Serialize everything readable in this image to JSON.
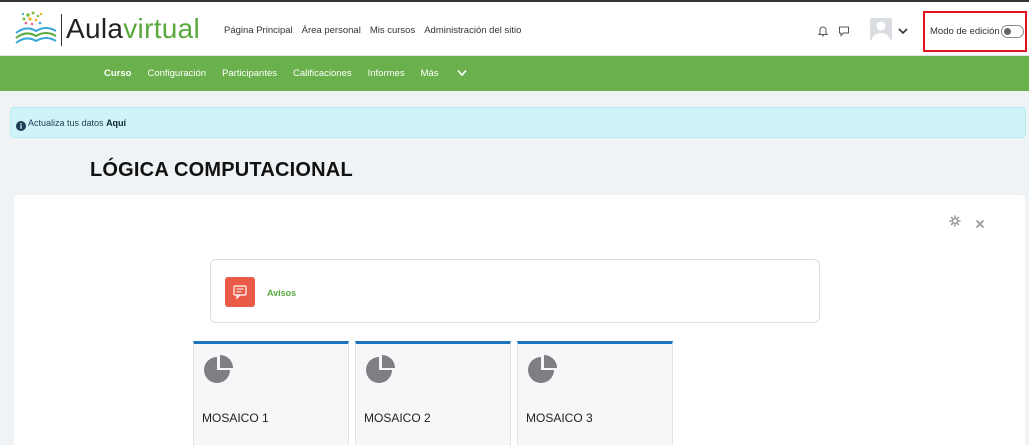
{
  "header": {
    "brand_prefix": "Aula",
    "brand_suffix": "virtual",
    "nav": [
      "Página Principal",
      "Área personal",
      "Mis cursos",
      "Administración del sitio"
    ],
    "edit_mode_label": "Modo de edición",
    "edit_mode_on": false
  },
  "course_nav": {
    "items": [
      "Curso",
      "Configuración",
      "Participantes",
      "Calificaciones",
      "Informes",
      "Más"
    ],
    "active": "Curso"
  },
  "alert": {
    "text": "Actualiza tus datos",
    "link": "Aquí"
  },
  "course": {
    "title": "LÓGICA COMPUTACIONAL"
  },
  "activity": {
    "label": "Avisos",
    "icon": "forum-icon"
  },
  "tiles": [
    {
      "label": "MOSAICO 1",
      "icon": "pie-chart-icon"
    },
    {
      "label": "MOSAICO 2",
      "icon": "pie-chart-icon"
    },
    {
      "label": "MOSAICO 3",
      "icon": "pie-chart-icon"
    }
  ],
  "colors": {
    "accent_green": "#6ab04c",
    "brand_green": "#5aa83e",
    "tile_top_border": "#1c75bc",
    "avisos_icon_bg": "#ea5b47",
    "alert_bg": "#cff4f8",
    "highlight_red": "#e0121d"
  }
}
